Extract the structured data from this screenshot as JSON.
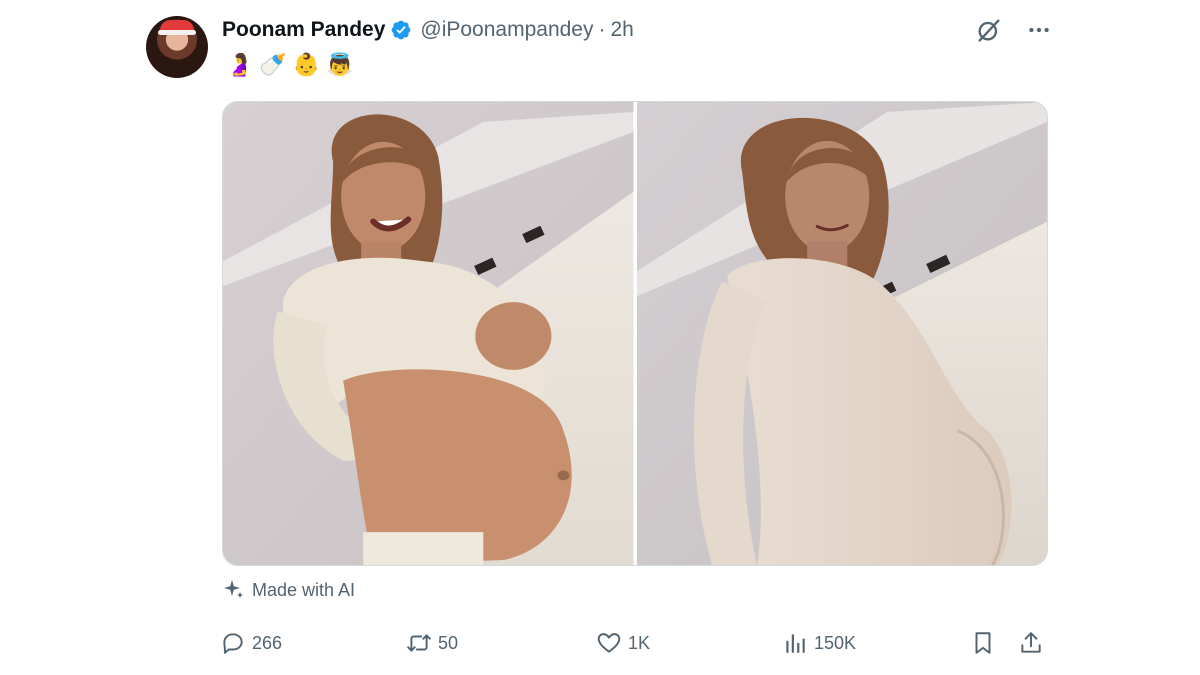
{
  "post": {
    "author_name": "Poonam Pandey",
    "handle": "@iPoonampandey",
    "separator": "·",
    "time": "2h",
    "text_emojis": [
      "🤰",
      "🍼",
      "👶",
      "👼"
    ],
    "ai_label": "Made with AI",
    "media_count": 2
  },
  "stats": {
    "replies": "266",
    "reposts": "50",
    "likes": "1K",
    "views": "150K"
  },
  "icons": {
    "verified": "verified-badge-icon",
    "grok": "grok-icon",
    "more": "more-options-icon",
    "ai": "sparkle-icon",
    "reply": "reply-icon",
    "repost": "repost-icon",
    "like": "heart-icon",
    "views": "views-chart-icon",
    "bookmark": "bookmark-icon",
    "share": "share-icon"
  },
  "colors": {
    "text_primary": "#0f1419",
    "text_secondary": "#536471",
    "verified_blue": "#1d9bf0",
    "border": "#cfd9de"
  }
}
